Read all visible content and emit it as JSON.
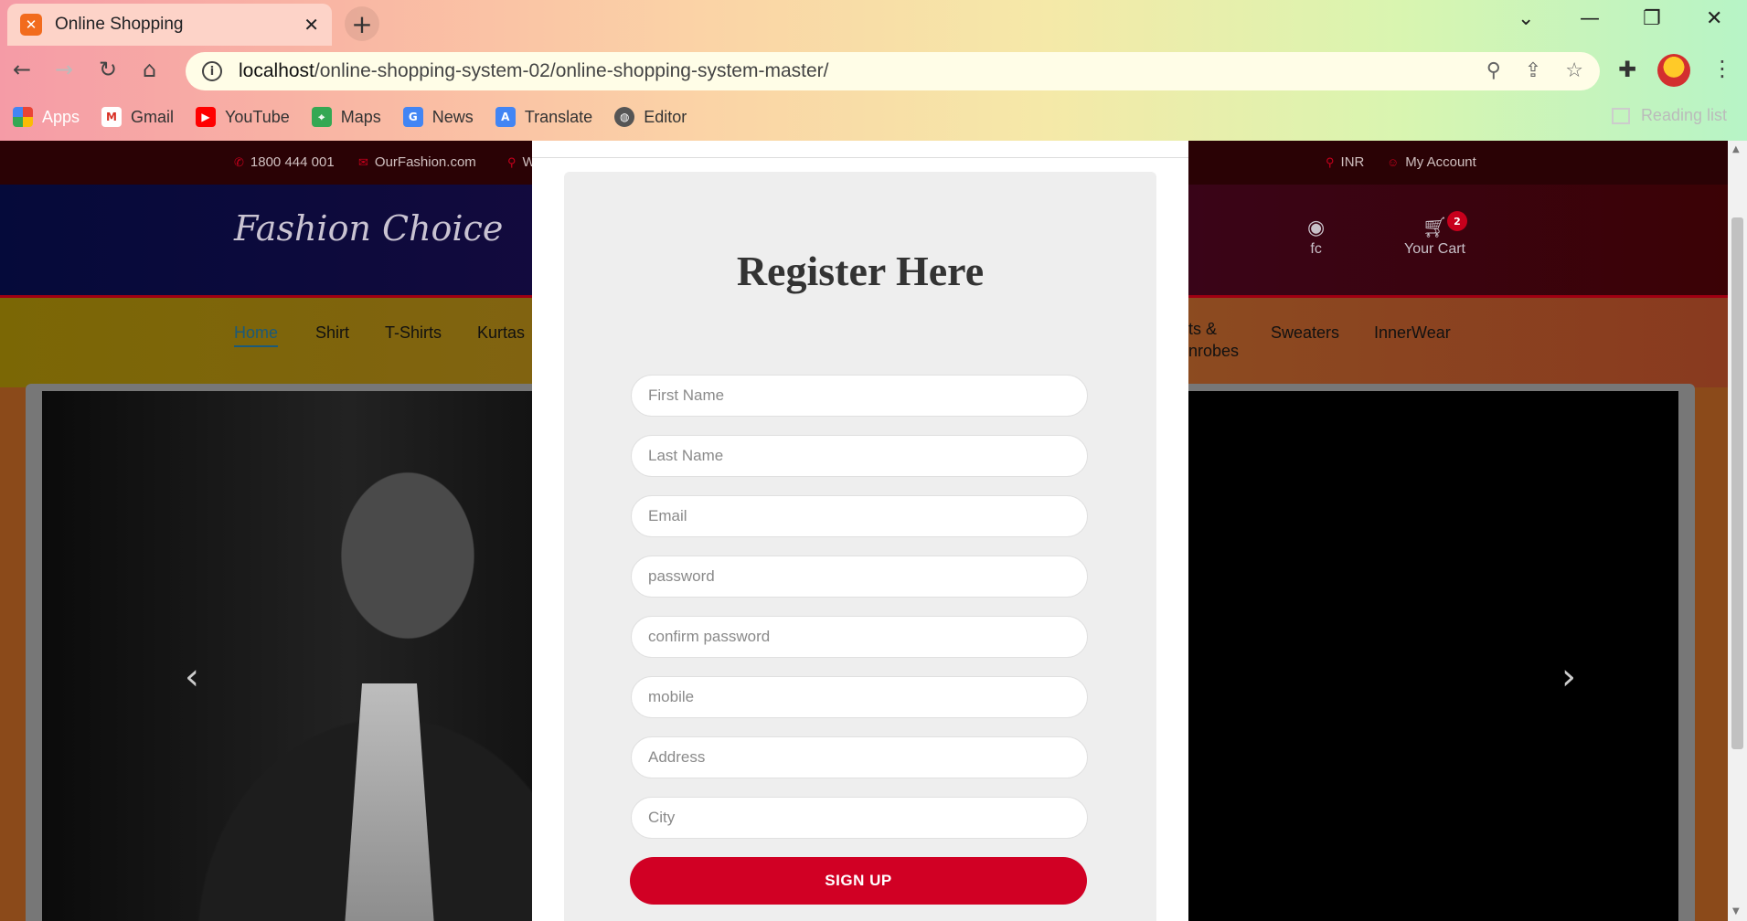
{
  "browser": {
    "tab_title": "Online Shopping",
    "tab_close": "✕",
    "new_tab": "+",
    "url_host": "localhost",
    "url_path": "/online-shopping-system-02/online-shopping-system-master/",
    "bookmarks": [
      "Apps",
      "Gmail",
      "YouTube",
      "Maps",
      "News",
      "Translate",
      "Editor"
    ],
    "reading_list": "Reading list"
  },
  "topbar": {
    "phone": "1800 444 001",
    "email": "OurFashion.com",
    "location_fragment": "W",
    "currency": "INR",
    "account": "My Account"
  },
  "header": {
    "logo": "Fashion Choice",
    "github_label": "fc",
    "cart_label": "Your Cart",
    "cart_count": "2"
  },
  "nav": {
    "items": [
      "Home",
      "Shirt",
      "T-Shirts",
      "Kurtas"
    ],
    "partial_item_line1": "ts &",
    "partial_item_line2": "nrobes",
    "right_items": [
      "Sweaters",
      "InnerWear"
    ]
  },
  "carousel": {
    "prev": "‹",
    "next": "›"
  },
  "register": {
    "title": "Register Here",
    "placeholders": {
      "first_name": "First Name",
      "last_name": "Last Name",
      "email": "Email",
      "password": "password",
      "confirm_password": "confirm password",
      "mobile": "mobile",
      "address": "Address",
      "city": "City"
    },
    "signup_label": "SIGN UP"
  },
  "colors": {
    "accent": "#d10024",
    "card_bg": "#eeeeee"
  }
}
